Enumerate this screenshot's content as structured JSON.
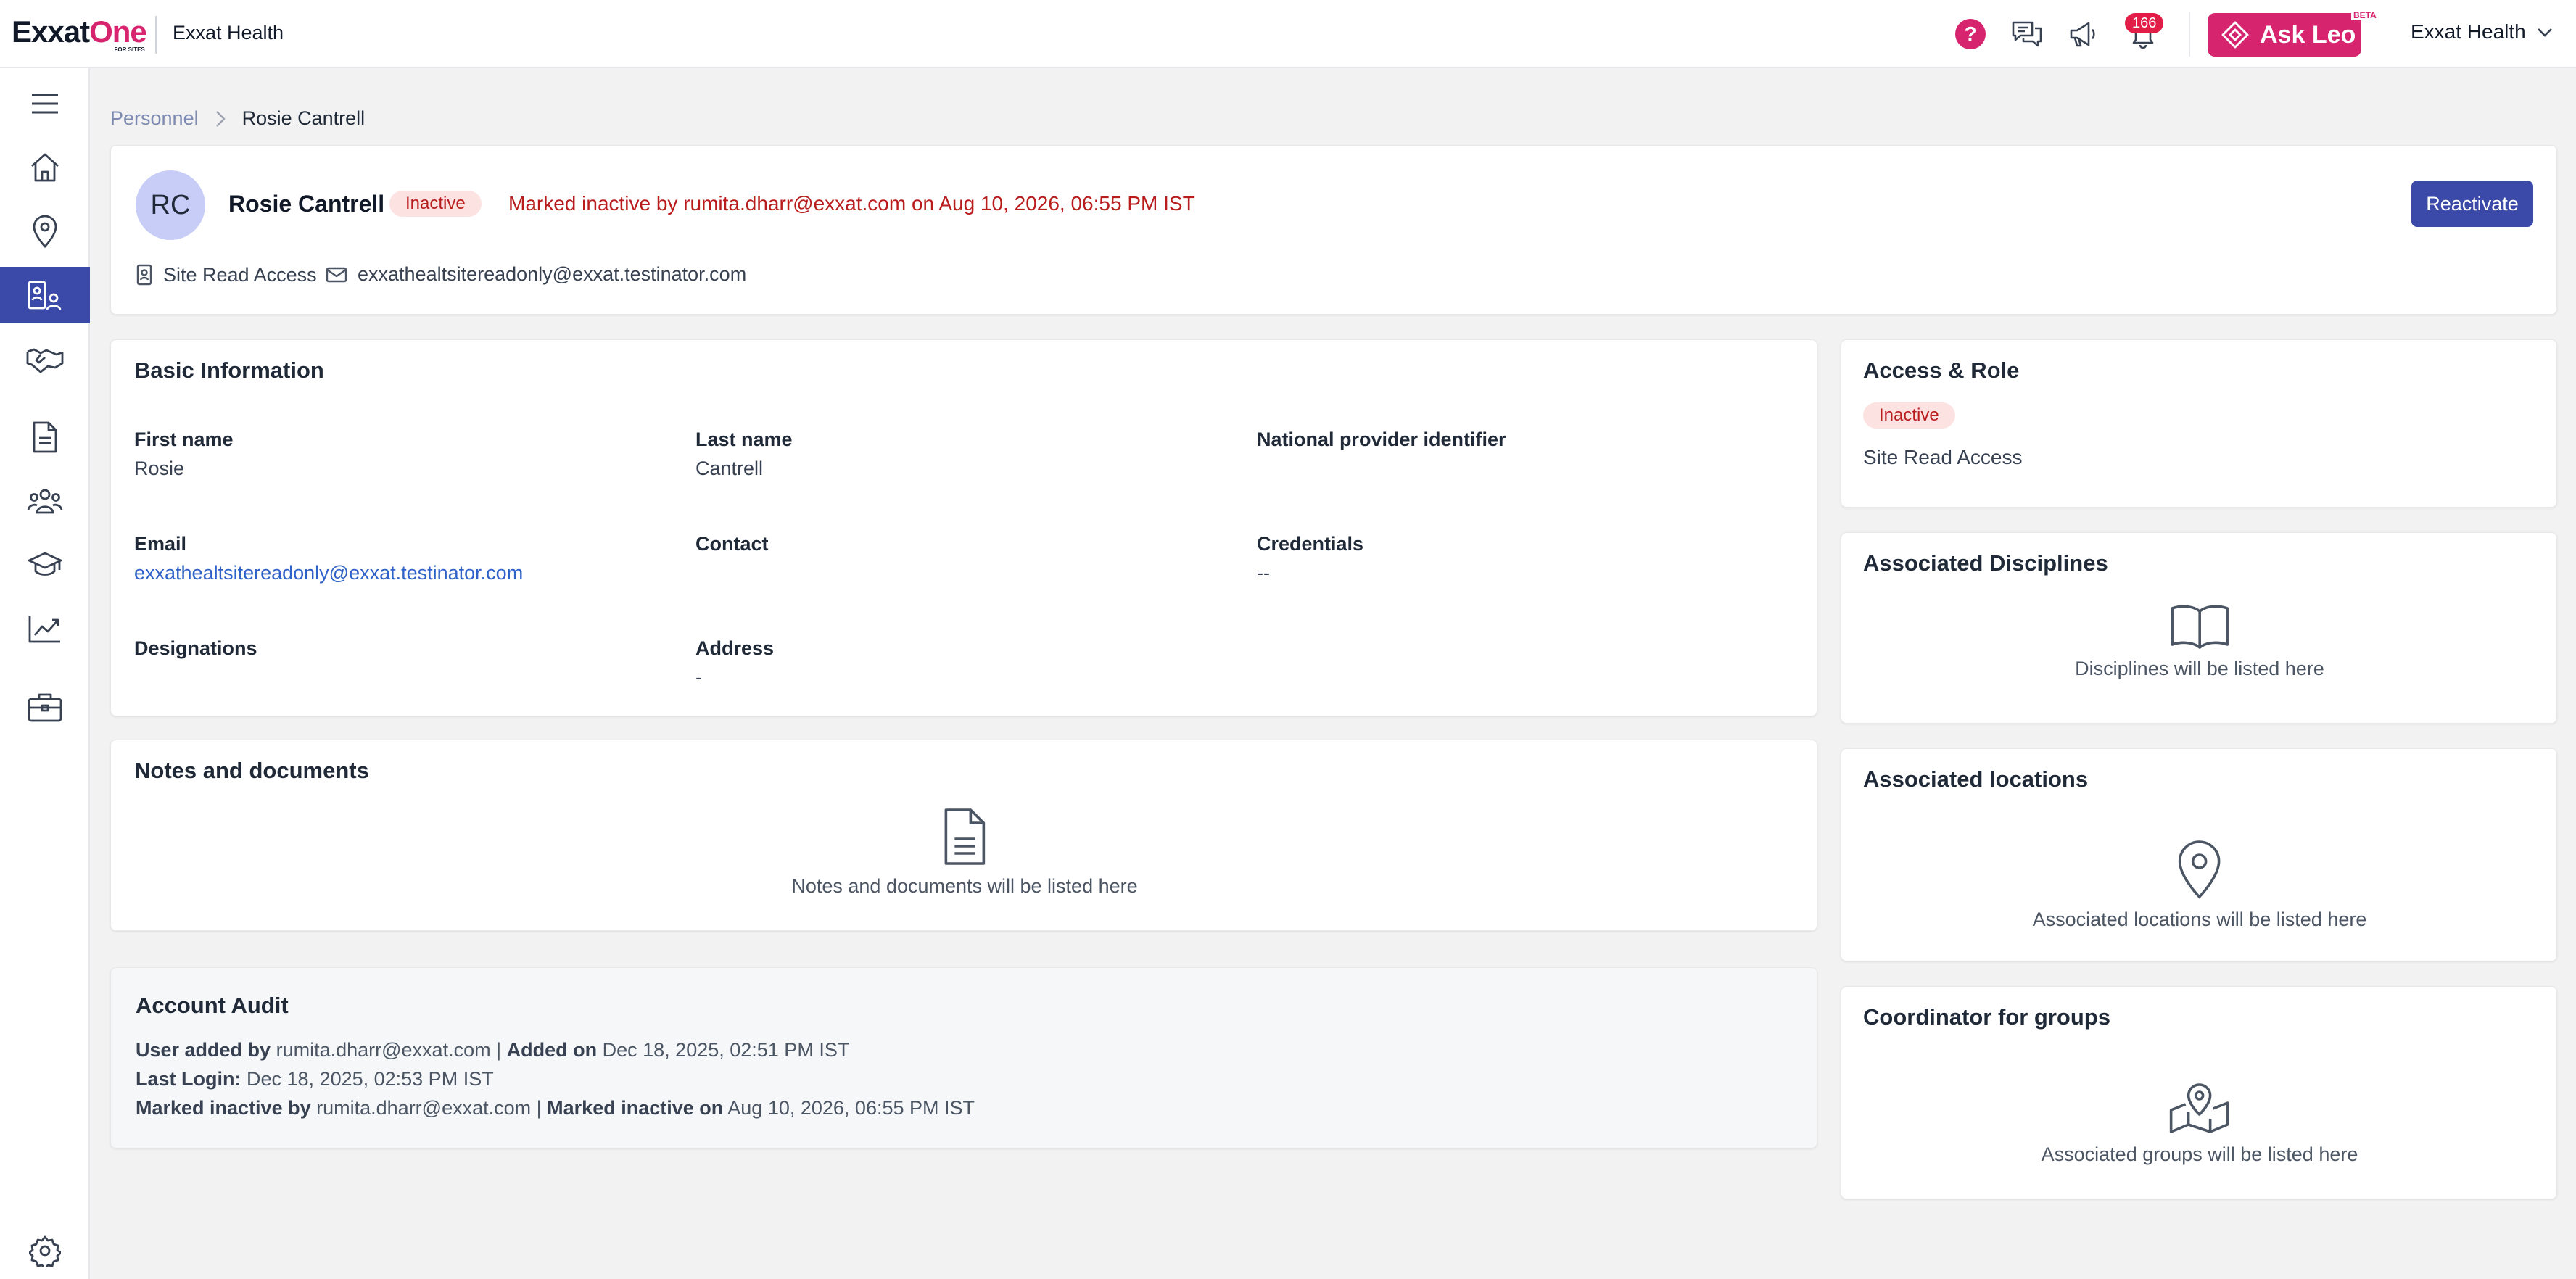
{
  "topbar": {
    "logo_main": "Exxat",
    "logo_accent": "One",
    "logo_sub": "FOR SITES",
    "org_name": "Exxat Health",
    "help_glyph": "?",
    "notification_count": "166",
    "ask_leo_label": "Ask Leo",
    "beta_label": "BETA",
    "org_switcher_label": "Exxat Health",
    "accent_color": "#d6246e"
  },
  "sidebar": {
    "items": [
      {
        "name": "menu",
        "icon": "hamburger-icon"
      },
      {
        "name": "home",
        "icon": "home-icon"
      },
      {
        "name": "locations",
        "icon": "map-pin-icon"
      },
      {
        "name": "personnel",
        "icon": "personnel-icon",
        "active": true
      },
      {
        "name": "partners",
        "icon": "handshake-icon"
      },
      {
        "name": "documents",
        "icon": "document-icon"
      },
      {
        "name": "groups",
        "icon": "people-icon"
      },
      {
        "name": "education",
        "icon": "graduation-cap-icon"
      },
      {
        "name": "reports",
        "icon": "chart-icon"
      },
      {
        "name": "jobs",
        "icon": "briefcase-icon"
      },
      {
        "name": "settings",
        "icon": "gear-icon"
      }
    ],
    "active_color": "#3b4aa8"
  },
  "breadcrumb": {
    "parent": "Personnel",
    "current": "Rosie Cantrell"
  },
  "profile": {
    "initials": "RC",
    "name": "Rosie Cantrell",
    "status": "Inactive",
    "inactive_note": "Marked inactive by rumita.dharr@exxat.com on Aug 10, 2026, 06:55 PM IST",
    "reactivate_label": "Reactivate",
    "role": "Site Read Access",
    "email": "exxathealtsitereadonly@exxat.testinator.com"
  },
  "basic_info": {
    "title": "Basic Information",
    "first_name_label": "First name",
    "first_name": "Rosie",
    "last_name_label": "Last name",
    "last_name": "Cantrell",
    "npi_label": "National provider identifier",
    "email_label": "Email",
    "email": "exxathealtsitereadonly@exxat.testinator.com",
    "contact_label": "Contact",
    "credentials_label": "Credentials",
    "credentials": "--",
    "designations_label": "Designations",
    "address_label": "Address",
    "address": "-"
  },
  "notes": {
    "title": "Notes and documents",
    "empty_text": "Notes and documents will be listed here"
  },
  "audit": {
    "title": "Account Audit",
    "line1": {
      "added_by_label": "User added by",
      "added_by": "rumita.dharr@exxat.com",
      "sep": "|",
      "added_on_label": "Added on",
      "added_on": "Dec 18, 2025, 02:51 PM IST"
    },
    "line2": {
      "last_login_label": "Last Login:",
      "last_login": "Dec 18, 2025, 02:53 PM IST"
    },
    "line3": {
      "inactive_by_label": "Marked inactive by",
      "inactive_by": "rumita.dharr@exxat.com",
      "sep": "|",
      "inactive_on_label": "Marked inactive on",
      "inactive_on": "Aug 10, 2026, 06:55 PM IST"
    }
  },
  "access_role": {
    "title": "Access & Role",
    "status": "Inactive",
    "role": "Site Read Access"
  },
  "disciplines": {
    "title": "Associated Disciplines",
    "empty_text": "Disciplines will be listed here"
  },
  "locations": {
    "title": "Associated locations",
    "empty_text": "Associated locations will be listed here"
  },
  "groups": {
    "title": "Coordinator for groups",
    "empty_text": "Associated groups will be listed here"
  }
}
